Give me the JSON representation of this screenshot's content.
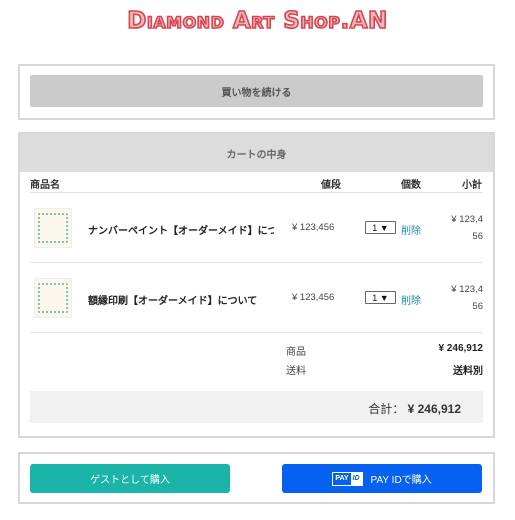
{
  "header": {
    "shop_name": "Diamond Art Shop.AN"
  },
  "continue": {
    "label": "買い物を続ける"
  },
  "cart": {
    "title": "カートの中身",
    "columns": {
      "name": "商品名",
      "price": "値段",
      "qty": "個数",
      "subtotal": "小計"
    },
    "items": [
      {
        "name": "ナンバーペイント【オーダーメイド】につ…",
        "price": "¥ 123,456",
        "qty": "1 ▼",
        "delete": "削除",
        "subtotal_line1": "¥ 123,4",
        "subtotal_line2": "56"
      },
      {
        "name": "額縁印刷【オーダーメイド】について",
        "price": "¥ 123,456",
        "qty": "1 ▼",
        "delete": "削除",
        "subtotal_line1": "¥ 123,4",
        "subtotal_line2": "56"
      }
    ],
    "summary": {
      "goods_label": "商品",
      "goods_value": "¥ 246,912",
      "shipping_label": "送料",
      "shipping_value": "送料別"
    },
    "total": {
      "label": "合計：",
      "value": "¥ 246,912"
    }
  },
  "payment": {
    "guest_label": "ゲストとして購入",
    "payid_logo_a": "PAY",
    "payid_logo_b": "ID",
    "payid_label": "PAY IDで購入"
  },
  "colors": {
    "guest_button": "#1ab4a8",
    "payid_button": "#0661f1",
    "delete_link": "#1a8fa0",
    "logo": "#d8454f"
  }
}
